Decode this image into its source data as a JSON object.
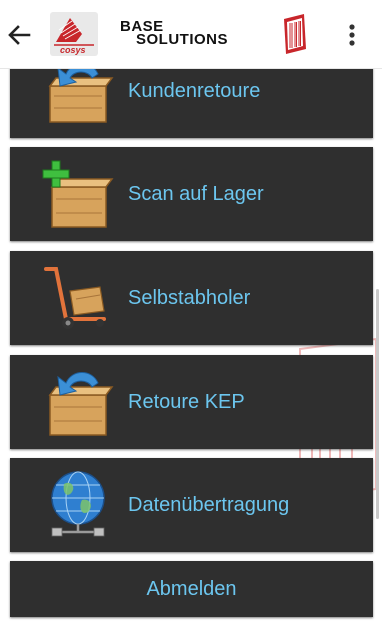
{
  "appbar": {
    "logo_text": "cosys",
    "brand_line1": "BASE",
    "brand_line2": "SOLUTIONS",
    "icons": [
      "arrow-back-icon",
      "cosys-logo",
      "barcode-icon",
      "more-vert-icon"
    ]
  },
  "menu": {
    "items": [
      {
        "label": "Kundenretoure",
        "icon": "box-return-icon"
      },
      {
        "label": "Scan auf Lager",
        "icon": "box-add-icon"
      },
      {
        "label": "Selbstabholer",
        "icon": "hand-truck-icon"
      },
      {
        "label": "Retoure KEP",
        "icon": "box-return-icon"
      },
      {
        "label": "Datenübertragung",
        "icon": "globe-network-icon"
      }
    ],
    "logout_label": "Abmelden"
  },
  "colors": {
    "tile_bg": "#2f2f2f",
    "label": "#6cc6ef",
    "accent_red": "#c8262b",
    "background": "#ffffff"
  }
}
